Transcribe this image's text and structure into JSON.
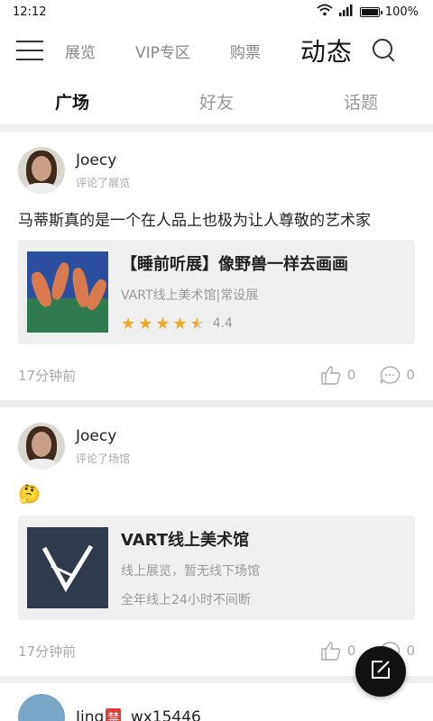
{
  "status_bar": {
    "time": "12:12",
    "battery": "100%"
  },
  "top_nav": {
    "items": [
      {
        "label": "展览"
      },
      {
        "label": "VIP专区"
      },
      {
        "label": "购票"
      },
      {
        "label": "动态"
      }
    ],
    "active": "动态"
  },
  "sub_tabs": [
    {
      "label": "广场",
      "active": true
    },
    {
      "label": "好友"
    },
    {
      "label": "话题"
    }
  ],
  "posts": [
    {
      "user": "Joecy",
      "action": "评论了展览",
      "text": "马蒂斯真的是一个在人品上也极为让人尊敬的艺术家",
      "card": {
        "title": "【睡前听展】像野兽一样去画画",
        "subtitle": "VART线上美术馆|常设展",
        "rating": "4.4",
        "stars": 4.5
      },
      "time": "17分钟前",
      "likes": "0",
      "comments": "0"
    },
    {
      "user": "Joecy",
      "action": "评论了场馆",
      "text": "🤔",
      "card": {
        "title": "VART线上美术馆",
        "subtitle": "线上展览，暂无线下场馆",
        "subtitle2": "全年线上24小时不间断"
      },
      "time": "17分钟前",
      "likes": "0",
      "comments": "0"
    },
    {
      "user_prefix": "Jing",
      "user_badge": "禁",
      "user_suffix": "_wx15446"
    }
  ],
  "colors": {
    "star": "#f5a623",
    "fab": "#111111",
    "divider": "#efefef"
  },
  "icons": [
    "menu-icon",
    "search-icon",
    "like-icon",
    "comment-icon",
    "edit-icon",
    "wifi-icon",
    "signal-icon",
    "battery-icon"
  ]
}
